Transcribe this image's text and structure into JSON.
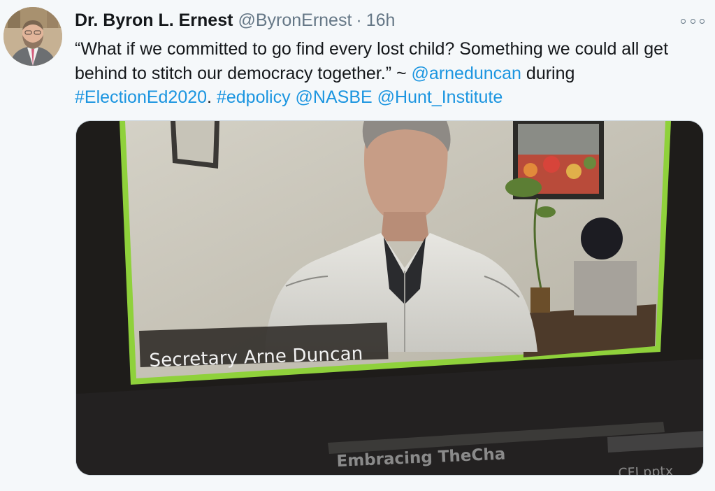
{
  "tweet": {
    "display_name": "Dr. Byron L. Ernest",
    "handle": "@ByronErnest",
    "separator": "·",
    "time": "16h",
    "text_part_1": "“What if we committed to go find every lost child? Something we could all get behind to stitch our democracy together.” ~ ",
    "mention_1": "@arneduncan",
    "text_part_2": " during ",
    "hashtag_1": "#ElectionEd2020",
    "text_part_3": ". ",
    "hashtag_2": "#edpolicy",
    "space_1": " ",
    "mention_2": "@NASBE",
    "space_2": " ",
    "mention_3": "@Hunt_Institute"
  },
  "media": {
    "caption": "Secretary Arne Duncan",
    "bottom_text": "Embracing TheCha",
    "bottom_text_2": "CFI.pptx"
  },
  "icons": {
    "more": "more-options-icon",
    "avatar": "profile-avatar"
  },
  "colors": {
    "link": "#1b95e0",
    "secondary_text": "#657786",
    "primary_text": "#14171a",
    "background": "#f5f8fa",
    "frame_green": "#8fd13b"
  }
}
